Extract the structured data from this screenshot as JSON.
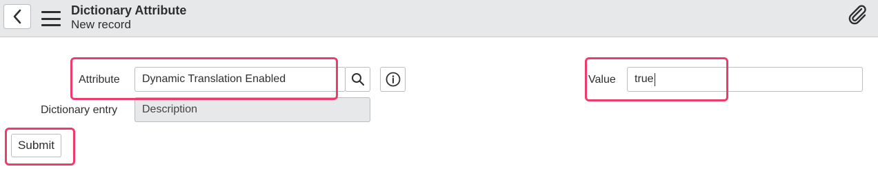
{
  "header": {
    "title": "Dictionary Attribute",
    "subtitle": "New record",
    "back_icon": "chevron-left-icon",
    "menu_icon": "hamburger-menu-icon",
    "attach_icon": "paperclip-icon"
  },
  "form": {
    "attribute": {
      "label": "Attribute",
      "value": "Dynamic Translation Enabled",
      "lookup_icon": "search-icon",
      "info_icon": "info-icon"
    },
    "dictionary_entry": {
      "label": "Dictionary entry",
      "value": "Description"
    },
    "value": {
      "label": "Value",
      "value": "true"
    },
    "submit_label": "Submit"
  },
  "colors": {
    "highlight": "#ef3b6c",
    "header_bg": "#e6e8ea",
    "readonly_bg": "#e6e8ea"
  }
}
